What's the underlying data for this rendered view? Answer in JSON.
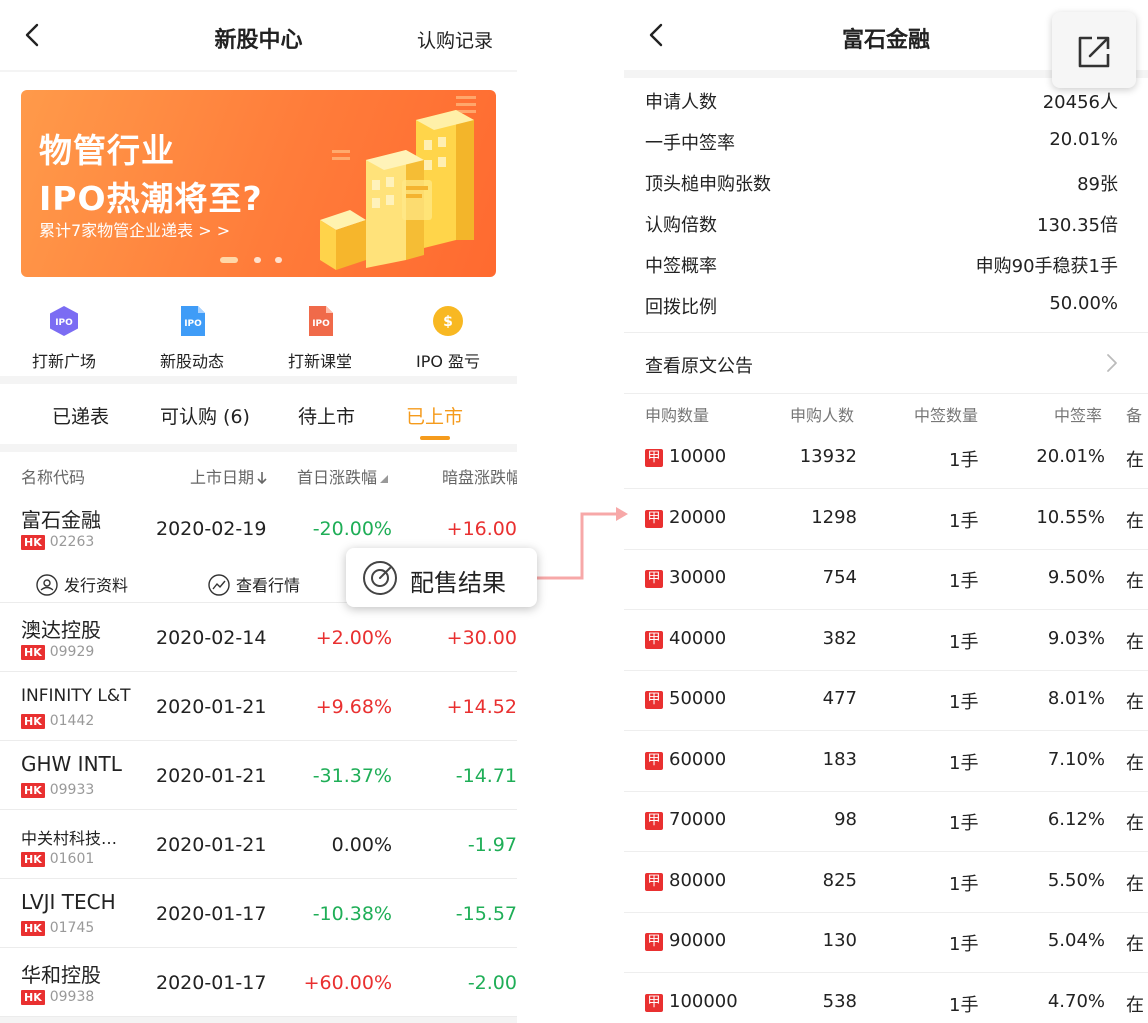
{
  "left": {
    "nav": {
      "title": "新股中心",
      "right_label": "认购记录"
    },
    "banner": {
      "line1": "物管行业",
      "line2": "IPO热潮将至?",
      "sub": "累计7家物管企业递表 > >"
    },
    "quick_actions": [
      {
        "label": "打新广场",
        "icon_text": "IPO",
        "color": "#7a6cf0"
      },
      {
        "label": "新股动态",
        "icon_text": "IPO",
        "color": "#3f9cf7"
      },
      {
        "label": "打新课堂",
        "icon_text": "IPO",
        "color": "#f06a4a"
      },
      {
        "label": "IPO 盈亏",
        "icon_text": "$",
        "color": "#f8b822"
      }
    ],
    "tabs": [
      {
        "label": "已递表"
      },
      {
        "label": "可认购 (6)"
      },
      {
        "label": "待上市"
      },
      {
        "label": "已上市"
      }
    ],
    "columns": {
      "name": "名称代码",
      "date": "上市日期",
      "first_day": "首日涨跌幅",
      "dark": "暗盘涨跌幅"
    },
    "rows": [
      {
        "name": "富石金融",
        "market": "HK",
        "code": "02263",
        "date": "2020-02-19",
        "change": "-20.00%",
        "dark": "+16.00",
        "change_dir": "neg",
        "dark_dir": "pos"
      },
      {
        "name": "澳达控股",
        "market": "HK",
        "code": "09929",
        "date": "2020-02-14",
        "change": "+2.00%",
        "dark": "+30.00",
        "change_dir": "pos",
        "dark_dir": "pos"
      },
      {
        "name": "INFINITY L&T",
        "market": "HK",
        "code": "01442",
        "date": "2020-01-21",
        "change": "+9.68%",
        "dark": "+14.52",
        "change_dir": "pos",
        "dark_dir": "pos"
      },
      {
        "name": "GHW INTL",
        "market": "HK",
        "code": "09933",
        "date": "2020-01-21",
        "change": "-31.37%",
        "dark": "-14.71",
        "change_dir": "neg",
        "dark_dir": "neg"
      },
      {
        "name": "中关村科技…",
        "market": "HK",
        "code": "01601",
        "date": "2020-01-21",
        "change": "0.00%",
        "dark": "-1.97",
        "change_dir": "zero",
        "dark_dir": "neg"
      },
      {
        "name": "LVJI TECH",
        "market": "HK",
        "code": "01745",
        "date": "2020-01-17",
        "change": "-10.38%",
        "dark": "-15.57",
        "change_dir": "neg",
        "dark_dir": "neg"
      },
      {
        "name": "华和控股",
        "market": "HK",
        "code": "09938",
        "date": "2020-01-17",
        "change": "+60.00%",
        "dark": "-2.00",
        "change_dir": "pos",
        "dark_dir": "neg"
      }
    ],
    "sub_actions": {
      "prospectus": "发行资料",
      "quotes": "查看行情"
    },
    "callout": {
      "label": "配售结果"
    }
  },
  "right": {
    "nav": {
      "title": "富石金融"
    },
    "stats": [
      {
        "key": "申请人数",
        "value": "20456人"
      },
      {
        "key": "一手中签率",
        "value": "20.01%"
      },
      {
        "key": "顶头槌申购张数",
        "value": "89张"
      },
      {
        "key": "认购倍数",
        "value": "130.35倍"
      },
      {
        "key": "中签概率",
        "value": "申购90手稳获1手"
      },
      {
        "key": "回拨比例",
        "value": "50.00%"
      }
    ],
    "announcement_link": "查看原文公告",
    "table_headers": {
      "qty": "申购数量",
      "applicants": "申购人数",
      "lots": "中签数量",
      "rate": "中签率",
      "note": "备"
    },
    "table_rows": [
      {
        "badge": "甲",
        "qty": "10000",
        "applicants": "13932",
        "lots": "1手",
        "rate": "20.01%",
        "note": "在"
      },
      {
        "badge": "甲",
        "qty": "20000",
        "applicants": "1298",
        "lots": "1手",
        "rate": "10.55%",
        "note": "在"
      },
      {
        "badge": "甲",
        "qty": "30000",
        "applicants": "754",
        "lots": "1手",
        "rate": "9.50%",
        "note": "在"
      },
      {
        "badge": "甲",
        "qty": "40000",
        "applicants": "382",
        "lots": "1手",
        "rate": "9.03%",
        "note": "在"
      },
      {
        "badge": "甲",
        "qty": "50000",
        "applicants": "477",
        "lots": "1手",
        "rate": "8.01%",
        "note": "在"
      },
      {
        "badge": "甲",
        "qty": "60000",
        "applicants": "183",
        "lots": "1手",
        "rate": "7.10%",
        "note": "在"
      },
      {
        "badge": "甲",
        "qty": "70000",
        "applicants": "98",
        "lots": "1手",
        "rate": "6.12%",
        "note": "在"
      },
      {
        "badge": "甲",
        "qty": "80000",
        "applicants": "825",
        "lots": "1手",
        "rate": "5.50%",
        "note": "在"
      },
      {
        "badge": "甲",
        "qty": "90000",
        "applicants": "130",
        "lots": "1手",
        "rate": "5.04%",
        "note": "在"
      },
      {
        "badge": "甲",
        "qty": "100000",
        "applicants": "538",
        "lots": "1手",
        "rate": "4.70%",
        "note": "在"
      }
    ]
  }
}
